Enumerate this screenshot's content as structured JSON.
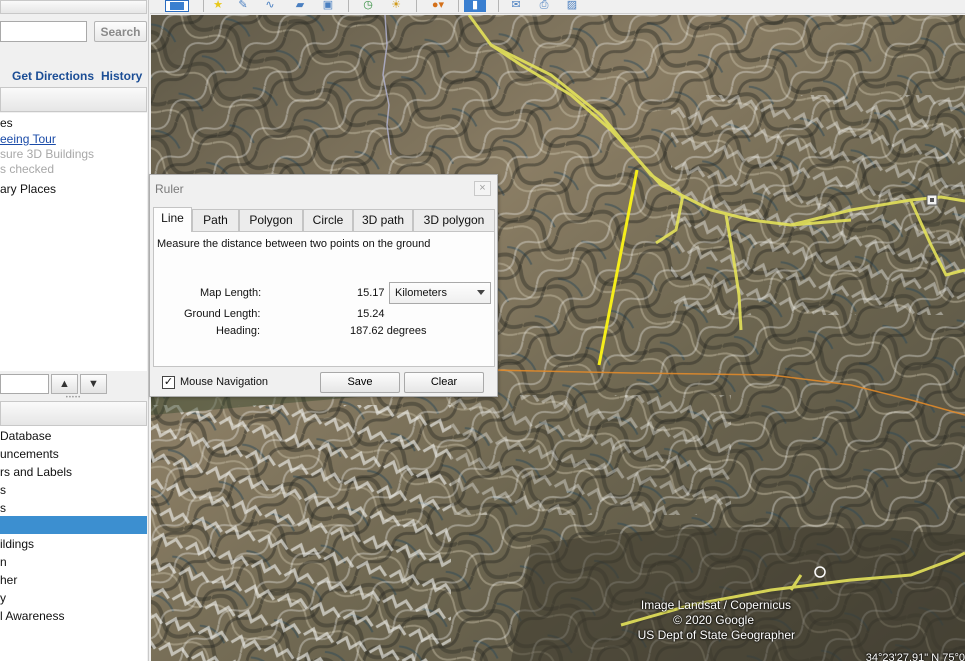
{
  "search": {
    "button_label": "Search",
    "value": ""
  },
  "nav_links": {
    "directions": "Get Directions",
    "history": "History"
  },
  "places": [
    {
      "label": "es",
      "style": "normal"
    },
    {
      "label": "eeing Tour",
      "style": "link"
    },
    {
      "label": "sure 3D Buildings",
      "style": "disabled"
    },
    {
      "label": "s checked",
      "style": "disabled"
    },
    {
      "label": "ary Places",
      "style": "normal"
    }
  ],
  "layers": [
    {
      "label": "Database"
    },
    {
      "label": "uncements"
    },
    {
      "label": "rs and Labels"
    },
    {
      "label": "s"
    },
    {
      "label": "s"
    },
    {
      "label": ""
    },
    {
      "label": "ildings"
    },
    {
      "label": "n"
    },
    {
      "label": "her"
    },
    {
      "label": "y"
    },
    {
      "label": "l Awareness"
    }
  ],
  "ruler": {
    "title": "Ruler",
    "tabs": [
      "Line",
      "Path",
      "Polygon",
      "Circle",
      "3D path",
      "3D polygon"
    ],
    "active_tab": "Line",
    "instruction": "Measure the distance between two points on the ground",
    "map_length_label": "Map Length:",
    "map_length_value": "15.17",
    "unit": "Kilometers",
    "ground_length_label": "Ground Length:",
    "ground_length_value": "15.24",
    "heading_label": "Heading:",
    "heading_value": "187.62 degrees",
    "mouse_navigation_label": "Mouse Navigation",
    "mouse_navigation_checked": true,
    "save_label": "Save",
    "clear_label": "Clear",
    "close_glyph": "×"
  },
  "attribution": {
    "line1": "Image Landsat / Copernicus",
    "line2": "© 2020 Google",
    "line3": "US Dept of State Geographer"
  },
  "coordinates": "34°23'27.91\" N    75°0",
  "colors": {
    "road": "#e4e25a",
    "ruler_line": "#f5ee1a",
    "border_line": "#e08a2a",
    "selection": "#3c8fd0"
  }
}
